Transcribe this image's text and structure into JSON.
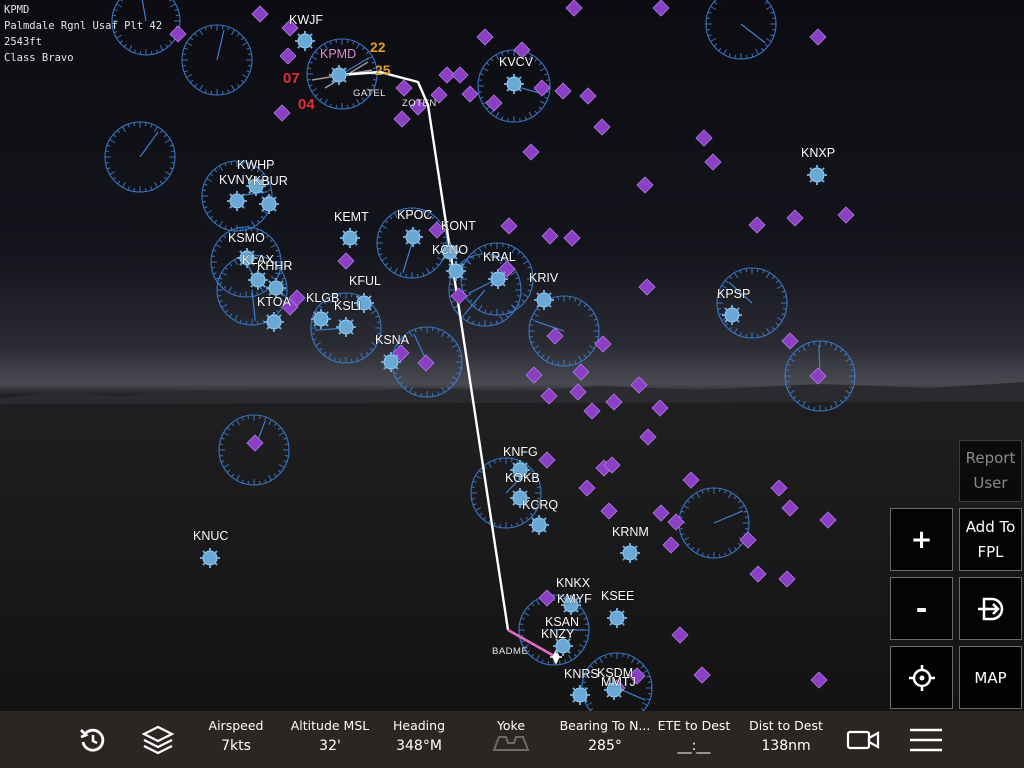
{
  "airport_info": {
    "ident": "KPMD",
    "name": "Palmdale Rgnl Usaf Plt 42",
    "elevation": "2543ft",
    "class": "Class Bravo"
  },
  "route": {
    "waypoints": [
      "KPMD",
      "GATEL",
      "ZOTEN",
      "BADME"
    ]
  },
  "runways": [
    "22",
    "25",
    "07",
    "04"
  ],
  "airports": [
    "KWJF",
    "KPMD",
    "KVCV",
    "KNXP",
    "KWHP",
    "KVNY",
    "KBUR",
    "KEMT",
    "KPOC",
    "KONT",
    "KCNO",
    "KSMO",
    "KLAX",
    "KHHR",
    "KRAL",
    "KFUL",
    "KRIV",
    "KLGB",
    "KSLI",
    "KTOA",
    "KPSP",
    "KSNA",
    "KNFG",
    "KOKB",
    "KCRQ",
    "KNUC",
    "KRNM",
    "KNKX",
    "KSEE",
    "KMYF",
    "KSAN",
    "KNZY",
    "KNRS",
    "KSDM",
    "MMTJ"
  ],
  "buttons": {
    "report_user": "Report User",
    "zoom_in": "+",
    "add_to_fpl": "Add To FPL",
    "zoom_out": "-",
    "map": "MAP"
  },
  "icons": {
    "direct_to": "direct-to-icon",
    "center": "crosshair-icon",
    "restart": "restart-icon",
    "layers": "layers-icon",
    "yoke": "yoke-icon",
    "camera": "camera-icon",
    "menu": "menu-icon"
  },
  "instruments": [
    {
      "label": "Airspeed",
      "value": "7kts"
    },
    {
      "label": "Altitude MSL",
      "value": "32'"
    },
    {
      "label": "Heading",
      "value": "348°M"
    },
    {
      "label": "Yoke",
      "value": ""
    },
    {
      "label": "Bearing To N...",
      "value": "285°"
    },
    {
      "label": "ETE to Dest",
      "value": "__:__"
    },
    {
      "label": "Dist to Dest",
      "value": "138nm"
    }
  ],
  "colors": {
    "airport": "#6aa9d6",
    "navaid": "#8a3fc4",
    "route": "#ffffff",
    "active_leg": "#e26cc4",
    "runway_red": "#e03030",
    "runway_orange": "#e39b2a",
    "origin_label": "#e38fd8",
    "range_ring": "#3d7fd0"
  }
}
